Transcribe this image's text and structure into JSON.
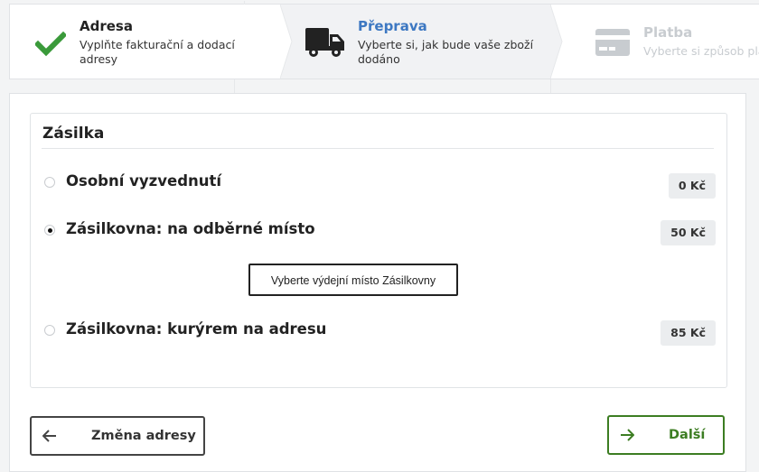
{
  "steps": [
    {
      "title": "Adresa",
      "desc_line1": "Vyplňte fakturační a dodací",
      "desc_line2": "adresy",
      "state": "done"
    },
    {
      "title": "Přeprava",
      "desc_line1": "Vyberte si, jak bude vaše zboží",
      "desc_line2": "dodáno",
      "state": "active"
    },
    {
      "title": "Platba",
      "desc_line1": "Vyberte si způsob pla",
      "state": "disabled"
    }
  ],
  "shipping": {
    "title": "Zásilka",
    "options": [
      {
        "label": "Osobní vyzvednutí",
        "price": "0 Kč",
        "selected": false
      },
      {
        "label": "Zásilkovna: na odběrné místo",
        "price": "50 Kč",
        "selected": true
      },
      {
        "label": "Zásilkovna: kurýrem na adresu",
        "price": "85 Kč",
        "selected": false
      }
    ],
    "pickup_button": "Vyberte výdejní místo Zásilkovny"
  },
  "actions": {
    "back_label": "Změna adresy",
    "next_label": "Další"
  },
  "colors": {
    "accent_blue": "#3d78c2",
    "success_green": "#3a9a3a",
    "next_green": "#3c7d22",
    "disabled_gray": "#c8ccd0"
  }
}
